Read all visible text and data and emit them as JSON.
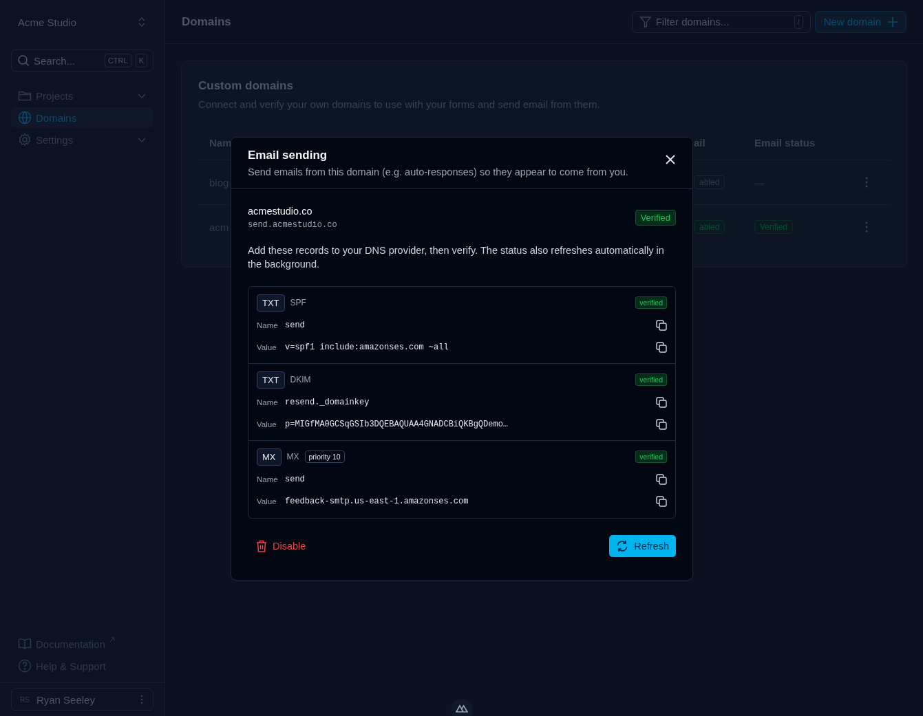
{
  "sidebar": {
    "workspace": "Acme Studio",
    "search": {
      "placeholder": "Search...",
      "keys": [
        "CTRL",
        "K"
      ]
    },
    "nav": [
      {
        "label": "Projects",
        "selected": false,
        "expandable": true
      },
      {
        "label": "Domains",
        "selected": true,
        "expandable": false
      },
      {
        "label": "Settings",
        "selected": false,
        "expandable": true
      }
    ],
    "footer_links": [
      {
        "label": "Documentation",
        "external": true
      },
      {
        "label": "Help & Support",
        "external": false
      }
    ],
    "user": {
      "initials": "RS",
      "name": "Ryan Seeley"
    }
  },
  "header": {
    "title": "Domains",
    "filter": {
      "placeholder": "Filter domains...",
      "key": "/"
    },
    "new_button": "New domain"
  },
  "card": {
    "title": "Custom domains",
    "description": "Connect and verify your own domains to use with your forms and send email from them.",
    "columns": {
      "name": "Nam",
      "email": "ail",
      "email_status": "Email status"
    },
    "rows": [
      {
        "name": "blog",
        "email": "abled",
        "email_on": false,
        "email_status": "—",
        "email_verified": false
      },
      {
        "name": "acm",
        "email": "abled",
        "email_on": true,
        "email_status": "Verified",
        "email_verified": true
      }
    ]
  },
  "modal": {
    "title": "Email sending",
    "description": "Send emails from this domain (e.g. auto-responses) so they appear to come from you.",
    "domain": {
      "name": "acmestudio.co",
      "subdomain": "send.acmestudio.co",
      "status": "Verified"
    },
    "instructions": "Add these records to your DNS provider, then verify. The status also refreshes automatically in the background.",
    "records": [
      {
        "type": "TXT",
        "label": "SPF",
        "status": "verified",
        "fields": [
          {
            "label": "Name",
            "value": "send"
          },
          {
            "label": "Value",
            "value": "v=spf1 include:amazonses.com ~all"
          }
        ]
      },
      {
        "type": "TXT",
        "label": "DKIM",
        "status": "verified",
        "fields": [
          {
            "label": "Name",
            "value": "resend._domainkey"
          },
          {
            "label": "Value",
            "value": "p=MIGfMA0GCSqGSIb3DQEBAQUAA4GNADCBiQKBgQDemo…"
          }
        ]
      },
      {
        "type": "MX",
        "label": "MX",
        "priority": "priority 10",
        "status": "verified",
        "fields": [
          {
            "label": "Name",
            "value": "send"
          },
          {
            "label": "Value",
            "value": "feedback-smtp.us-east-1.amazonses.com"
          }
        ]
      }
    ],
    "disable_button": "Disable",
    "refresh_button": "Refresh"
  }
}
